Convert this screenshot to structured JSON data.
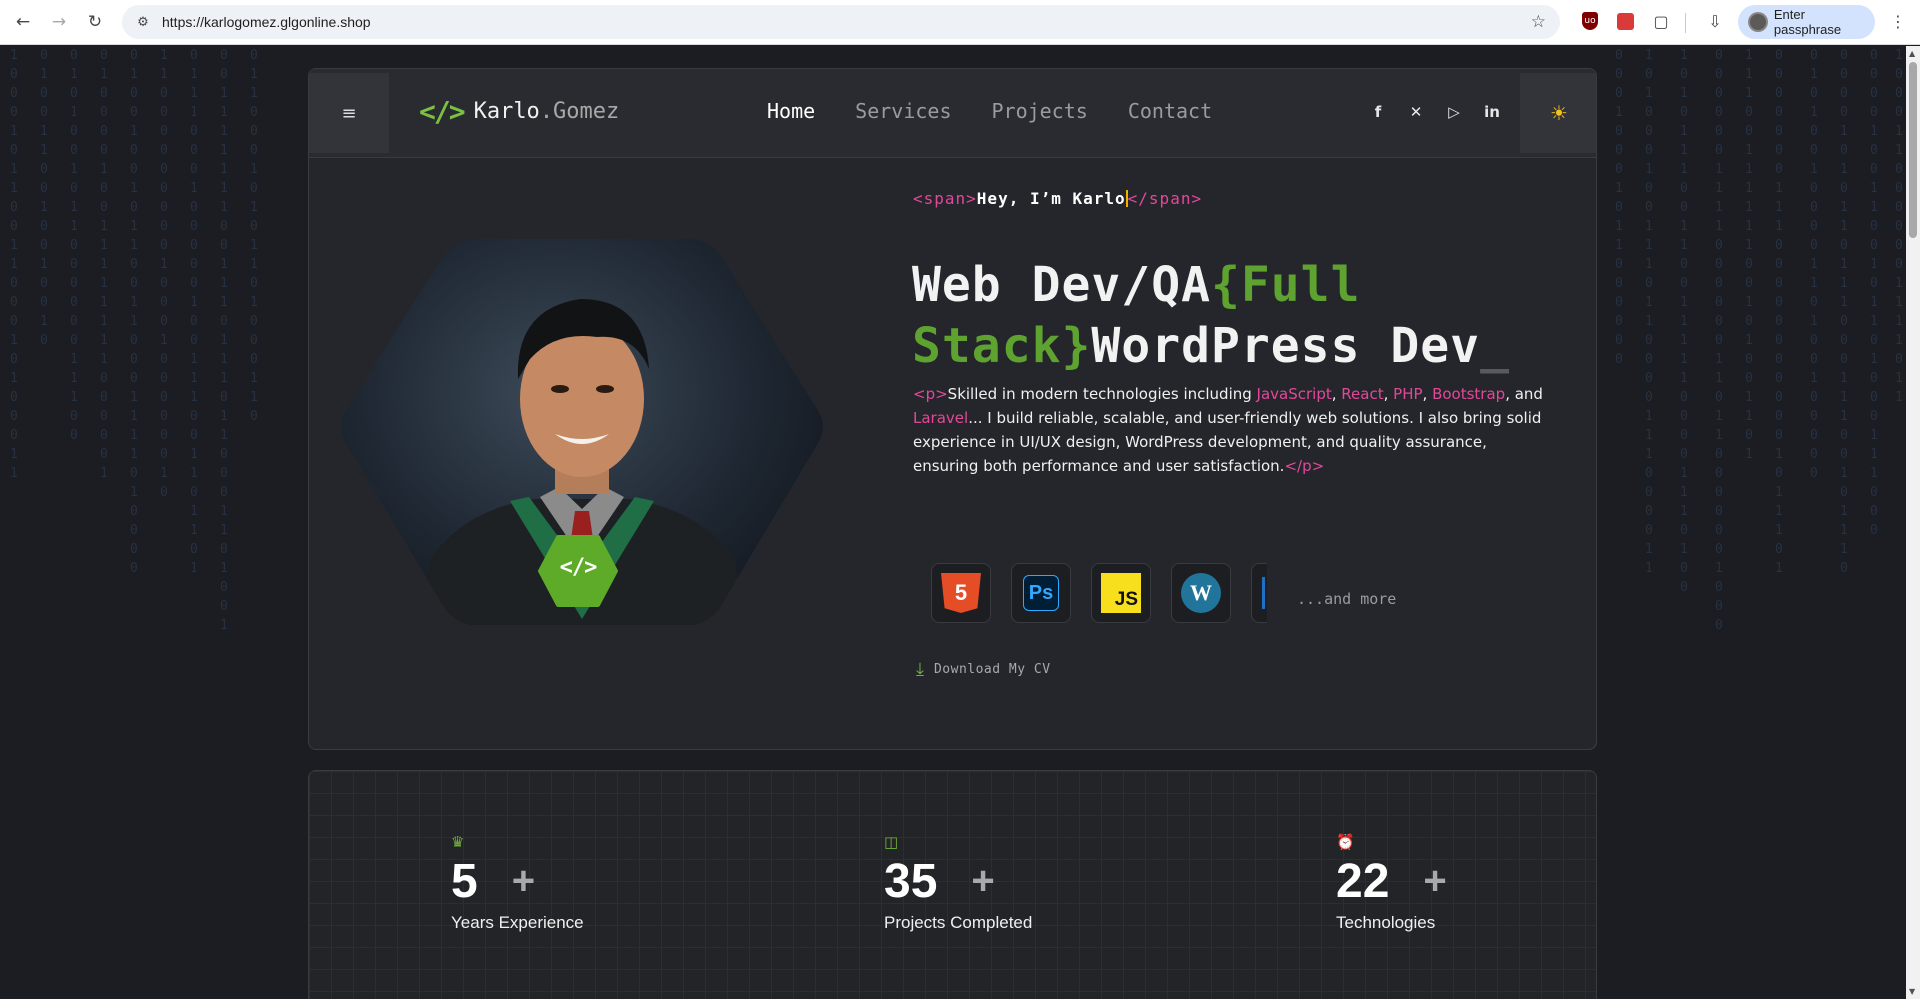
{
  "browser": {
    "url": "https://karlogomez.glgonline.shop",
    "profile_label": "Enter passphrase"
  },
  "site": {
    "logo_mark": "</>",
    "logo_first": "Karlo",
    "logo_second": ".Gomez",
    "nav": [
      {
        "label": "Home",
        "active": true
      },
      {
        "label": "Services",
        "active": false
      },
      {
        "label": "Projects",
        "active": false
      },
      {
        "label": "Contact",
        "active": false
      }
    ],
    "socials": [
      "facebook-icon",
      "x-icon",
      "youtube-icon",
      "linkedin-icon"
    ]
  },
  "hero": {
    "eyebrow_open": "<span>",
    "eyebrow_text": "Hey, I’m Karlo",
    "eyebrow_close": "</span>",
    "headline_part1": "Web Dev/QA",
    "headline_accent": "{Full Stack}",
    "headline_part2": "WordPress Dev",
    "headline_cursor": "_",
    "desc": {
      "open_tag": "<p>",
      "intro": "Skilled in modern technologies including ",
      "t1": "JavaScript",
      "s1": ", ",
      "t2": "React",
      "s2": ", ",
      "t3": "PHP",
      "s3": ", ",
      "t4": "Bootstrap",
      "s4": ", and ",
      "t5": "Laravel",
      "s5": "... ",
      "body": "I build reliable, scalable, and user-friendly web solutions. I also bring solid experience in UI/UX design, WordPress development, and quality assurance, ensuring both performance and user satisfaction.",
      "close_tag": "</p>"
    },
    "tech_icons": [
      {
        "name": "html5-icon",
        "glyph": "5"
      },
      {
        "name": "photoshop-icon",
        "glyph": "Ps"
      },
      {
        "name": "javascript-icon",
        "glyph": "JS"
      },
      {
        "name": "wordpress-icon",
        "glyph": "W"
      }
    ],
    "and_more": "...and more",
    "cv_label": "Download My CV",
    "badge": "</>"
  },
  "stats": [
    {
      "icon": "crown-icon",
      "value": "5",
      "plus": "+",
      "label": "Years Experience"
    },
    {
      "icon": "monitor-icon",
      "value": "35",
      "plus": "+",
      "label": "Projects Completed"
    },
    {
      "icon": "alarm-clock-icon",
      "value": "22",
      "plus": "+",
      "label": "Technologies"
    }
  ],
  "colors": {
    "accent_green": "#5ea230",
    "tag_pink": "#e2489a",
    "background": "#1c1d22"
  }
}
